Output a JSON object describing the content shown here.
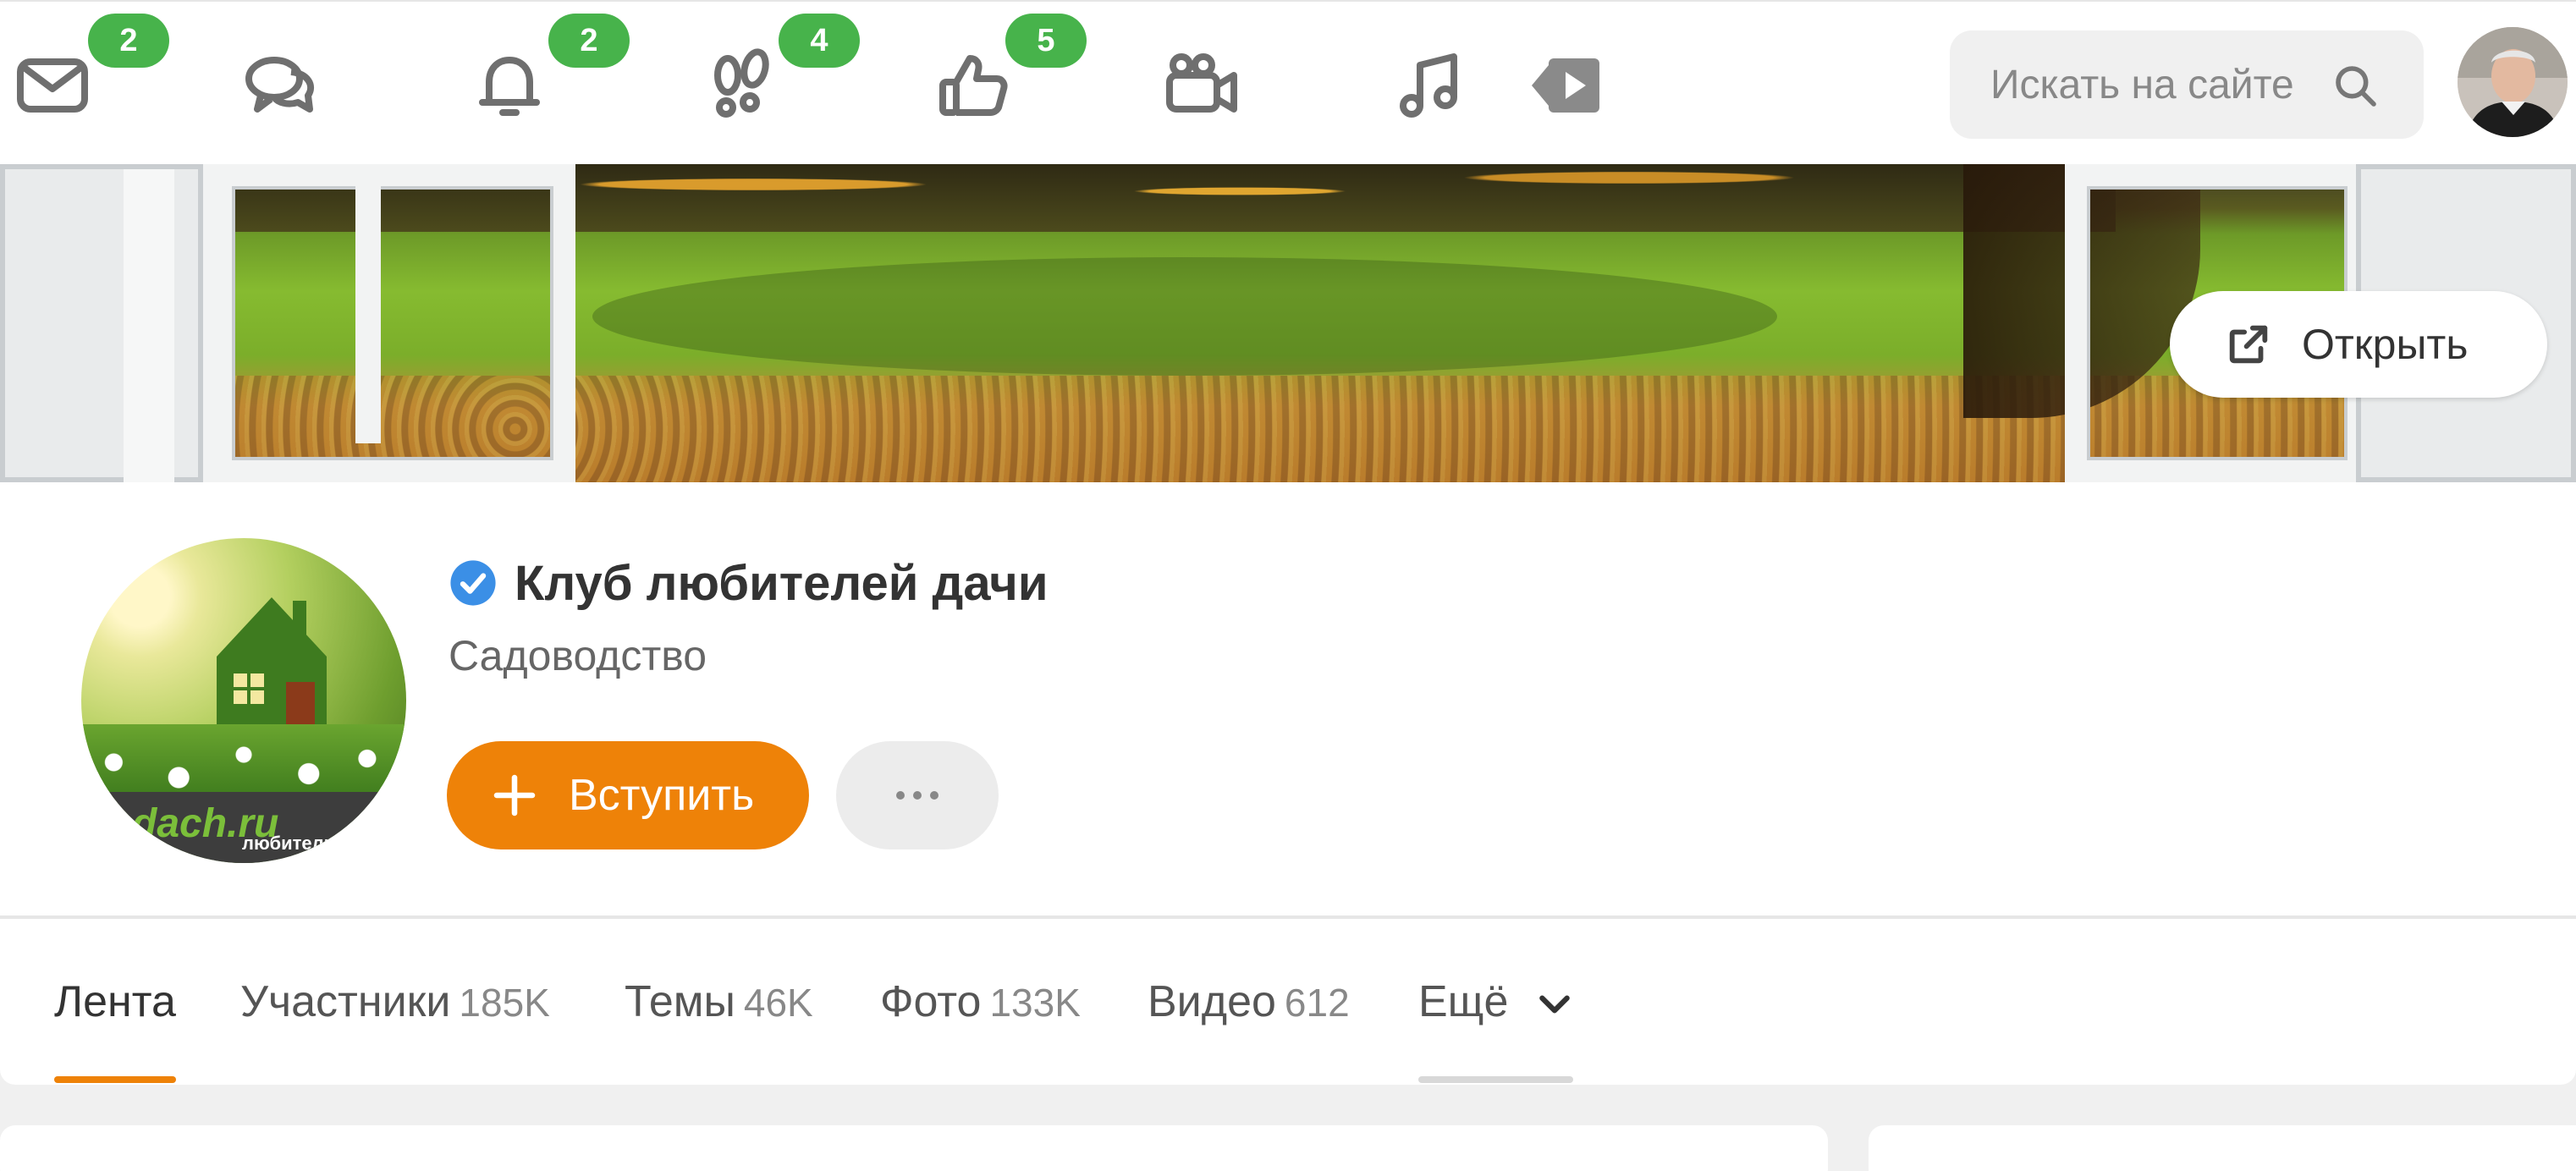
{
  "nav": {
    "messages": {
      "icon": "envelope-icon",
      "badge": "2"
    },
    "discussions": {
      "icon": "chat-bubbles-icon"
    },
    "notifications": {
      "icon": "bell-icon",
      "badge": "2"
    },
    "guests": {
      "icon": "footprints-icon",
      "badge": "4"
    },
    "events": {
      "icon": "thumbs-up-icon",
      "badge": "5"
    },
    "video_calls": {
      "icon": "video-camera-icon"
    },
    "music": {
      "icon": "music-note-icon"
    },
    "video": {
      "icon": "play-icon"
    }
  },
  "search": {
    "placeholder": "Искать на сайте"
  },
  "banner": {
    "open_label": "Открыть"
  },
  "group": {
    "title": "Клуб любителей дачи",
    "category": "Садоводство",
    "join_label": "Вступить",
    "avatar_logo_text": "dach.ru",
    "avatar_caption": "любители"
  },
  "tabs": [
    {
      "label": "Лента",
      "count": ""
    },
    {
      "label": "Участники",
      "count": "185K"
    },
    {
      "label": "Темы",
      "count": "46K"
    },
    {
      "label": "Фото",
      "count": "133K"
    },
    {
      "label": "Видео",
      "count": "612"
    },
    {
      "label": "Ещё",
      "count": ""
    }
  ],
  "colors": {
    "accent": "#ee8208",
    "badge": "#47b34b",
    "verified": "#3b8fe6"
  }
}
